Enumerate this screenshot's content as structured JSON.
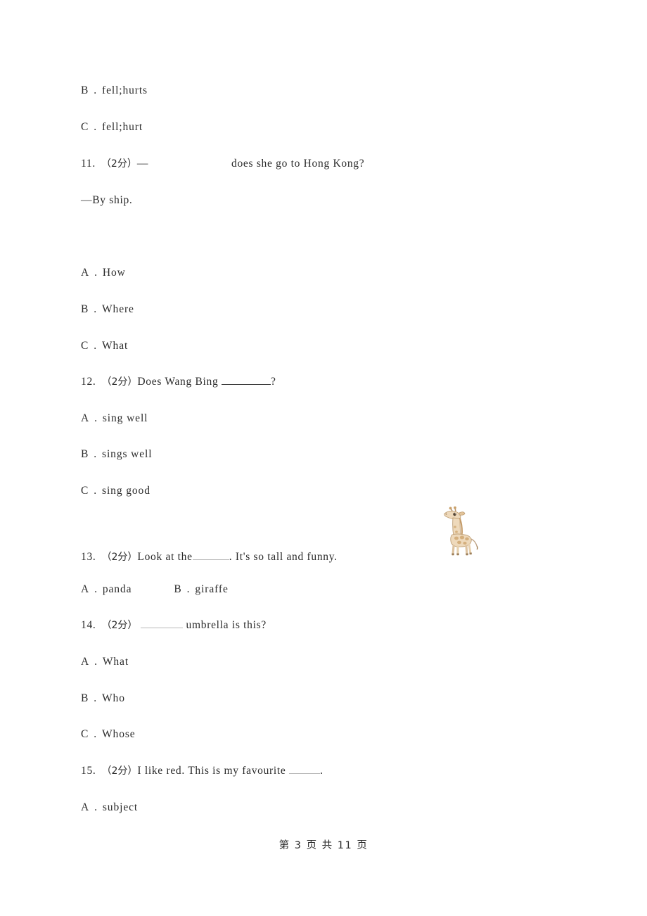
{
  "document": {
    "type": "exam-paper",
    "language": "en-CN",
    "page_background": "#ffffff",
    "text_color": "#2b2b2b"
  },
  "content": {
    "carryover_options": [
      {
        "label": "B",
        "sep": ".",
        "text": "fell;hurts"
      },
      {
        "label": "C",
        "sep": ".",
        "text": "fell;hurt"
      }
    ],
    "questions": [
      {
        "number": "11.",
        "score": "（2分）",
        "stem_before": "—",
        "stem_blank": "gap",
        "stem_after": "does she go to Hong Kong?",
        "stem_line2": "—By ship.",
        "options": [
          {
            "label": "A",
            "sep": ".",
            "text": "How"
          },
          {
            "label": "B",
            "sep": ".",
            "text": "Where"
          },
          {
            "label": "C",
            "sep": ".",
            "text": "What"
          }
        ]
      },
      {
        "number": "12.",
        "score": "（2分）",
        "stem_before": "Does Wang Bing ",
        "stem_blank": "solid",
        "stem_after": "?",
        "options": [
          {
            "label": "A",
            "sep": ".",
            "text": "sing well"
          },
          {
            "label": "B",
            "sep": ".",
            "text": "sings well"
          },
          {
            "label": "C",
            "sep": ".",
            "text": "sing good"
          }
        ]
      },
      {
        "number": "13.",
        "score": "（2分）",
        "stem_before": "Look at the",
        "stem_blank": "light",
        "stem_after": ". It's so tall and funny.",
        "options": [
          {
            "label": "A",
            "sep": ".",
            "text": "panda"
          },
          {
            "label": "B",
            "sep": ".",
            "text": "giraffe"
          }
        ]
      },
      {
        "number": "14.",
        "score": "（2分）",
        "stem_before": " ",
        "stem_blank": "light",
        "stem_after": " umbrella is this?",
        "options": [
          {
            "label": "A",
            "sep": ".",
            "text": "What"
          },
          {
            "label": "B",
            "sep": ".",
            "text": "Who"
          },
          {
            "label": "C",
            "sep": ".",
            "text": "Whose"
          }
        ]
      },
      {
        "number": "15.",
        "score": "（2分）",
        "stem_before": "I like red. This is my favourite ",
        "stem_blank": "light",
        "stem_after": ".",
        "options": [
          {
            "label": "A",
            "sep": ".",
            "text": "subject"
          }
        ]
      }
    ],
    "illustration": {
      "name": "giraffe-clipart",
      "alt": "giraffe",
      "body_color": "#e8cfa8",
      "spot_color": "#c9a06a",
      "outline_color": "#b5926b"
    },
    "footer": {
      "text": "第 3 页 共 11 页",
      "current_page": "3",
      "total_pages": "11"
    }
  }
}
